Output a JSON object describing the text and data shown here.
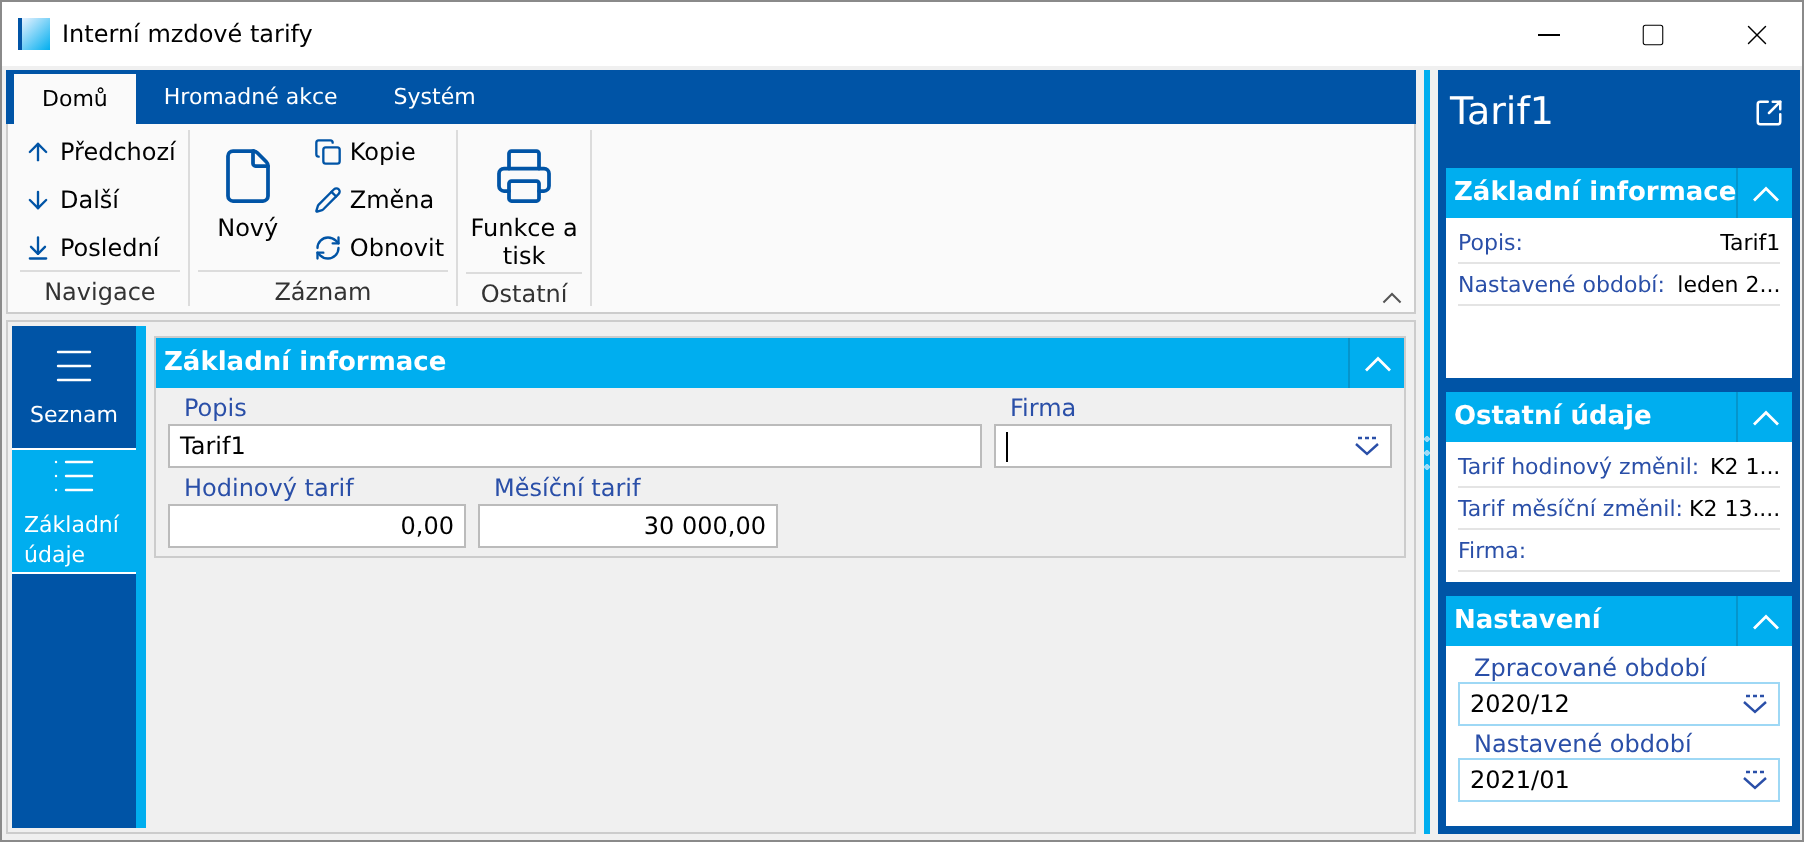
{
  "window": {
    "title": "Interní mzdové tarify"
  },
  "tabs": [
    {
      "label": "Domů",
      "selected": true
    },
    {
      "label": "Hromadné akce",
      "selected": false
    },
    {
      "label": "Systém",
      "selected": false
    }
  ],
  "ribbon": {
    "groups": [
      {
        "label": "Navigace",
        "items": [
          {
            "label": "Předchozí",
            "kind": "small"
          },
          {
            "label": "Další",
            "kind": "small"
          },
          {
            "label": "Poslední",
            "kind": "small"
          }
        ]
      },
      {
        "label": "Záznam",
        "items": [
          {
            "label": "Nový",
            "kind": "large"
          },
          {
            "label": "Kopie",
            "kind": "small"
          },
          {
            "label": "Změna",
            "kind": "small"
          },
          {
            "label": "Obnovit",
            "kind": "small"
          }
        ]
      },
      {
        "label": "Ostatní",
        "items": [
          {
            "label": "Funkce a tisk",
            "kind": "large"
          }
        ]
      }
    ]
  },
  "nav": [
    {
      "label": "Seznam",
      "selected": false
    },
    {
      "label": "Základní údaje",
      "selected": true
    }
  ],
  "form": {
    "title": "Základní informace",
    "popis": {
      "label": "Popis",
      "value": "Tarif1"
    },
    "firma": {
      "label": "Firma"
    },
    "tariffs": [
      {
        "label": "Hodinový tarif",
        "value": "0,00"
      },
      {
        "label": "Měsíční tarif",
        "value": "30 000,00"
      }
    ]
  },
  "side_panel": {
    "title": "Tarif1",
    "info": {
      "title": "Základní informace",
      "rows": [
        {
          "label": "Popis:",
          "value": "Tarif1"
        },
        {
          "label": "Nastavené období:",
          "value": "leden 2..."
        }
      ]
    },
    "other": {
      "title": "Ostatní údaje",
      "rows": [
        {
          "label": "Tarif hodinový změnil:",
          "value": "K2 1..."
        },
        {
          "label": "Tarif měsíční změnil:",
          "value": "K2 13...."
        },
        {
          "label": "Firma:"
        }
      ]
    },
    "settings": {
      "title": "Nastavení",
      "fields": [
        {
          "label": "Zpracované období",
          "value": "2020/12"
        },
        {
          "label": "Nastavené období",
          "value": "2021/01"
        }
      ]
    }
  }
}
